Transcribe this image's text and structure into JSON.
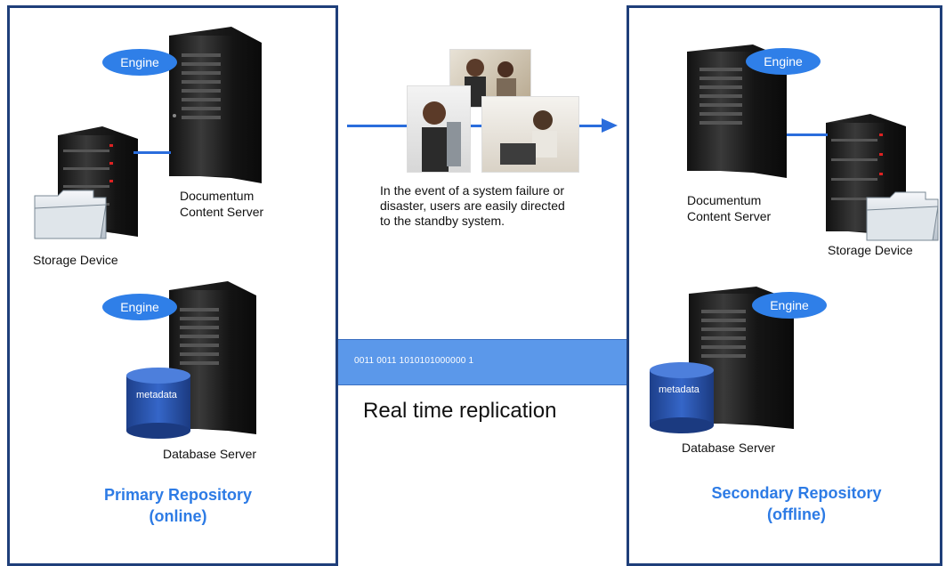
{
  "primary": {
    "engine_top": "Engine",
    "content_server": "Documentum\nContent Server",
    "storage": "Storage Device",
    "engine_db": "Engine",
    "metadata": "metadata",
    "db_server": "Database Server",
    "repo_line1": "Primary Repository",
    "repo_line2": "(online)"
  },
  "secondary": {
    "engine_top": "Engine",
    "content_server": "Documentum\nContent Server",
    "storage": "Storage Device",
    "engine_db": "Engine",
    "metadata": "metadata",
    "db_server": "Database Server",
    "repo_line1": "Secondary Repository",
    "repo_line2": "(offline)"
  },
  "center": {
    "caption": "In the event of a system failure or\ndisaster, users are easily directed\nto the standby system.",
    "bits": "0011 0011  1010101000000 1",
    "replication": "Real time replication"
  },
  "colors": {
    "border": "#1f3f7a",
    "accent": "#2d7be5",
    "engine": "#2f7fe8",
    "bar": "#5b98ea"
  }
}
